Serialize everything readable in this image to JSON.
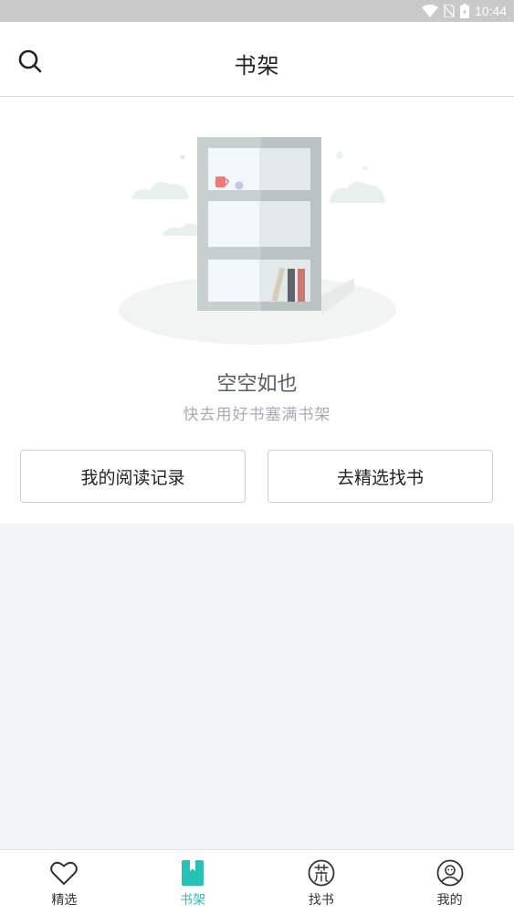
{
  "status_bar": {
    "time": "10:44",
    "icons": [
      "wifi-icon",
      "no-sim-icon",
      "battery-charging-icon"
    ]
  },
  "header": {
    "title": "书架",
    "search_icon": "search-icon"
  },
  "empty_state": {
    "title": "空空如也",
    "subtitle": "快去用好书塞满书架",
    "illustration": "empty-bookshelf-illustration"
  },
  "actions": {
    "reading_history": "我的阅读记录",
    "browse_featured": "去精选找书"
  },
  "bottom_nav": {
    "items": [
      {
        "label": "精选",
        "icon": "heart-icon",
        "active": false
      },
      {
        "label": "书架",
        "icon": "bookmark-icon",
        "active": true
      },
      {
        "label": "找书",
        "icon": "huang-char-icon",
        "active": false
      },
      {
        "label": "我的",
        "icon": "profile-icon",
        "active": false
      }
    ]
  },
  "colors": {
    "accent": "#26c2b8",
    "background": "#f3f4f8",
    "shelf": "#c9d0d0"
  }
}
